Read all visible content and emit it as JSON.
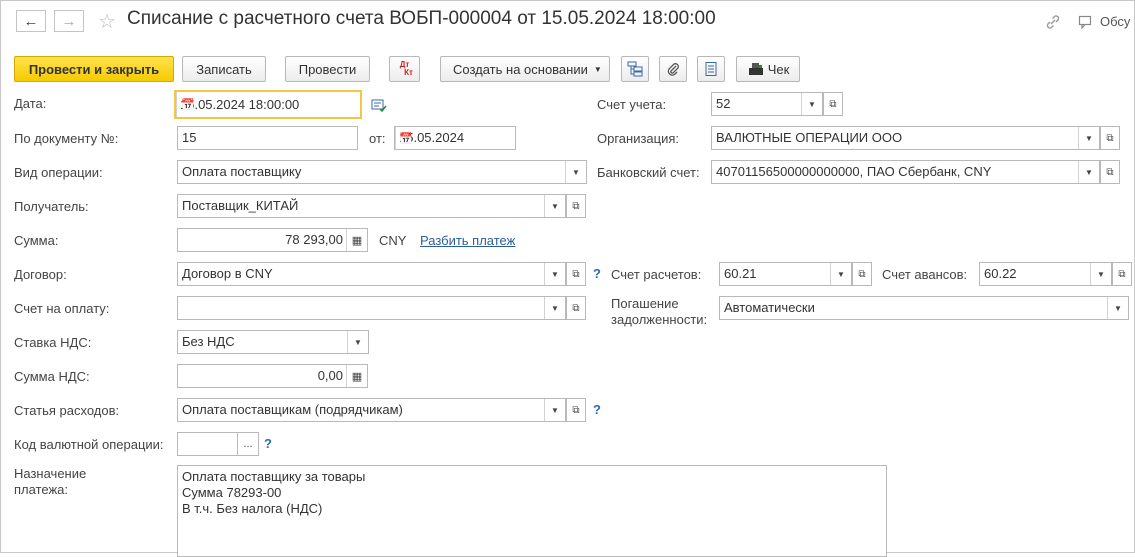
{
  "window": {
    "title": "Списание с расчетного счета ВОБП-000004 от 15.05.2024 18:00:00",
    "discuss_label": "Обсу"
  },
  "toolbar": {
    "post_close": "Провести и закрыть",
    "save": "Записать",
    "post": "Провести",
    "dtkt_top": "Дт",
    "dtkt_bottom": "Кт",
    "create_based_on": "Создать на основании",
    "receipt": "Чек"
  },
  "fields": {
    "date": {
      "label": "Дата:",
      "value": "15.05.2024 18:00:00"
    },
    "doc_number": {
      "label": "По документу №:",
      "value": "15"
    },
    "doc_date": {
      "label": "от:",
      "value": "15.05.2024"
    },
    "operation_type": {
      "label": "Вид операции:",
      "value": "Оплата поставщику"
    },
    "recipient": {
      "label": "Получатель:",
      "value": "Поставщик_КИТАЙ"
    },
    "amount": {
      "label": "Сумма:",
      "value": "78 293,00",
      "currency": "CNY",
      "split_link": "Разбить платеж"
    },
    "contract": {
      "label": "Договор:",
      "value": "Договор в CNY",
      "help": "?"
    },
    "invoice": {
      "label": "Счет на оплату:",
      "value": ""
    },
    "vat_rate": {
      "label": "Ставка НДС:",
      "value": "Без НДС"
    },
    "vat_amount": {
      "label": "Сумма НДС:",
      "value": "0,00"
    },
    "expense_item": {
      "label": "Статья расходов:",
      "value": "Оплата поставщикам (подрядчикам)",
      "help": "?"
    },
    "currency_op_code": {
      "label": "Код валютной операции:",
      "value": "",
      "button": "...",
      "help": "?"
    },
    "purpose": {
      "label_line1": "Назначение",
      "label_line2": "платежа:",
      "value": "Оплата поставщику за товары\nСумма 78293-00\nВ т.ч. Без налога (НДС)"
    },
    "account": {
      "label": "Счет учета:",
      "value": "52"
    },
    "organization": {
      "label": "Организация:",
      "value": "ВАЛЮТНЫЕ ОПЕРАЦИИ ООО"
    },
    "bank_account": {
      "label": "Банковский счет:",
      "value": "40701156500000000000, ПАО Сбербанк, CNY"
    },
    "settlement_account": {
      "label": "Счет расчетов:",
      "value": "60.21"
    },
    "advance_account": {
      "label": "Счет авансов:",
      "value": "60.22"
    },
    "debt_repayment": {
      "label_line1": "Погашение",
      "label_line2": "задолженности:",
      "value": "Автоматически"
    }
  },
  "colors": {
    "primary_button": "#f5cb00",
    "focus_border": "#f2c744",
    "link": "#2a5d9e"
  }
}
